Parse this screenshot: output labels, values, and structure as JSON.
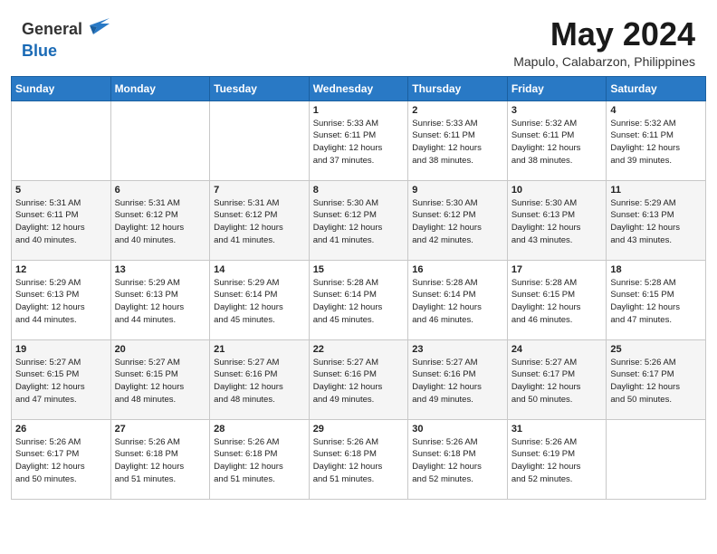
{
  "logo": {
    "general": "General",
    "blue": "Blue"
  },
  "title": "May 2024",
  "subtitle": "Mapulo, Calabarzon, Philippines",
  "days": [
    "Sunday",
    "Monday",
    "Tuesday",
    "Wednesday",
    "Thursday",
    "Friday",
    "Saturday"
  ],
  "weeks": [
    [
      {
        "day": "",
        "info": ""
      },
      {
        "day": "",
        "info": ""
      },
      {
        "day": "",
        "info": ""
      },
      {
        "day": "1",
        "info": "Sunrise: 5:33 AM\nSunset: 6:11 PM\nDaylight: 12 hours\nand 37 minutes."
      },
      {
        "day": "2",
        "info": "Sunrise: 5:33 AM\nSunset: 6:11 PM\nDaylight: 12 hours\nand 38 minutes."
      },
      {
        "day": "3",
        "info": "Sunrise: 5:32 AM\nSunset: 6:11 PM\nDaylight: 12 hours\nand 38 minutes."
      },
      {
        "day": "4",
        "info": "Sunrise: 5:32 AM\nSunset: 6:11 PM\nDaylight: 12 hours\nand 39 minutes."
      }
    ],
    [
      {
        "day": "5",
        "info": "Sunrise: 5:31 AM\nSunset: 6:11 PM\nDaylight: 12 hours\nand 40 minutes."
      },
      {
        "day": "6",
        "info": "Sunrise: 5:31 AM\nSunset: 6:12 PM\nDaylight: 12 hours\nand 40 minutes."
      },
      {
        "day": "7",
        "info": "Sunrise: 5:31 AM\nSunset: 6:12 PM\nDaylight: 12 hours\nand 41 minutes."
      },
      {
        "day": "8",
        "info": "Sunrise: 5:30 AM\nSunset: 6:12 PM\nDaylight: 12 hours\nand 41 minutes."
      },
      {
        "day": "9",
        "info": "Sunrise: 5:30 AM\nSunset: 6:12 PM\nDaylight: 12 hours\nand 42 minutes."
      },
      {
        "day": "10",
        "info": "Sunrise: 5:30 AM\nSunset: 6:13 PM\nDaylight: 12 hours\nand 43 minutes."
      },
      {
        "day": "11",
        "info": "Sunrise: 5:29 AM\nSunset: 6:13 PM\nDaylight: 12 hours\nand 43 minutes."
      }
    ],
    [
      {
        "day": "12",
        "info": "Sunrise: 5:29 AM\nSunset: 6:13 PM\nDaylight: 12 hours\nand 44 minutes."
      },
      {
        "day": "13",
        "info": "Sunrise: 5:29 AM\nSunset: 6:13 PM\nDaylight: 12 hours\nand 44 minutes."
      },
      {
        "day": "14",
        "info": "Sunrise: 5:29 AM\nSunset: 6:14 PM\nDaylight: 12 hours\nand 45 minutes."
      },
      {
        "day": "15",
        "info": "Sunrise: 5:28 AM\nSunset: 6:14 PM\nDaylight: 12 hours\nand 45 minutes."
      },
      {
        "day": "16",
        "info": "Sunrise: 5:28 AM\nSunset: 6:14 PM\nDaylight: 12 hours\nand 46 minutes."
      },
      {
        "day": "17",
        "info": "Sunrise: 5:28 AM\nSunset: 6:15 PM\nDaylight: 12 hours\nand 46 minutes."
      },
      {
        "day": "18",
        "info": "Sunrise: 5:28 AM\nSunset: 6:15 PM\nDaylight: 12 hours\nand 47 minutes."
      }
    ],
    [
      {
        "day": "19",
        "info": "Sunrise: 5:27 AM\nSunset: 6:15 PM\nDaylight: 12 hours\nand 47 minutes."
      },
      {
        "day": "20",
        "info": "Sunrise: 5:27 AM\nSunset: 6:15 PM\nDaylight: 12 hours\nand 48 minutes."
      },
      {
        "day": "21",
        "info": "Sunrise: 5:27 AM\nSunset: 6:16 PM\nDaylight: 12 hours\nand 48 minutes."
      },
      {
        "day": "22",
        "info": "Sunrise: 5:27 AM\nSunset: 6:16 PM\nDaylight: 12 hours\nand 49 minutes."
      },
      {
        "day": "23",
        "info": "Sunrise: 5:27 AM\nSunset: 6:16 PM\nDaylight: 12 hours\nand 49 minutes."
      },
      {
        "day": "24",
        "info": "Sunrise: 5:27 AM\nSunset: 6:17 PM\nDaylight: 12 hours\nand 50 minutes."
      },
      {
        "day": "25",
        "info": "Sunrise: 5:26 AM\nSunset: 6:17 PM\nDaylight: 12 hours\nand 50 minutes."
      }
    ],
    [
      {
        "day": "26",
        "info": "Sunrise: 5:26 AM\nSunset: 6:17 PM\nDaylight: 12 hours\nand 50 minutes."
      },
      {
        "day": "27",
        "info": "Sunrise: 5:26 AM\nSunset: 6:18 PM\nDaylight: 12 hours\nand 51 minutes."
      },
      {
        "day": "28",
        "info": "Sunrise: 5:26 AM\nSunset: 6:18 PM\nDaylight: 12 hours\nand 51 minutes."
      },
      {
        "day": "29",
        "info": "Sunrise: 5:26 AM\nSunset: 6:18 PM\nDaylight: 12 hours\nand 51 minutes."
      },
      {
        "day": "30",
        "info": "Sunrise: 5:26 AM\nSunset: 6:18 PM\nDaylight: 12 hours\nand 52 minutes."
      },
      {
        "day": "31",
        "info": "Sunrise: 5:26 AM\nSunset: 6:19 PM\nDaylight: 12 hours\nand 52 minutes."
      },
      {
        "day": "",
        "info": ""
      }
    ]
  ]
}
